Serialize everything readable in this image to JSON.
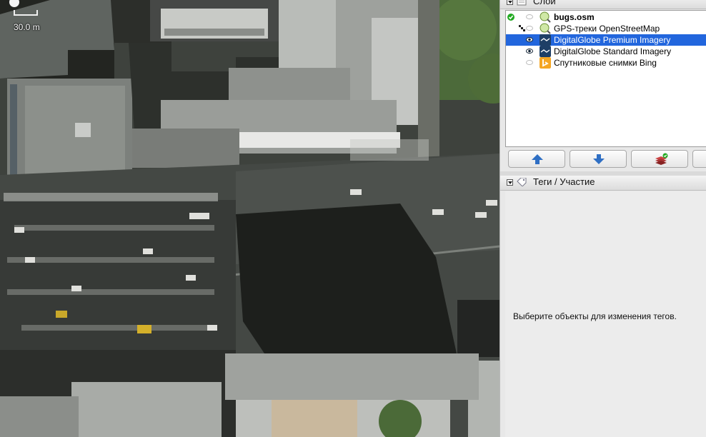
{
  "map": {
    "scale_label": "30.0 m"
  },
  "layers_panel": {
    "title": "Слои",
    "layers": [
      {
        "name": "bugs.osm",
        "bold": true,
        "selected": false,
        "status": "active",
        "visible": false,
        "icon": "osm-data-icon"
      },
      {
        "name": "GPS-треки OpenStreetMap",
        "bold": false,
        "selected": false,
        "status": "none",
        "visible": false,
        "icon": "gps-tracks-icon"
      },
      {
        "name": "DigitalGlobe Premium Imagery",
        "bold": false,
        "selected": true,
        "status": "none",
        "visible": true,
        "icon": "imagery-icon"
      },
      {
        "name": "DigitalGlobe Standard Imagery",
        "bold": false,
        "selected": false,
        "status": "none",
        "visible": true,
        "icon": "imagery-icon"
      },
      {
        "name": "Спутниковые снимки Bing",
        "bold": false,
        "selected": false,
        "status": "none",
        "visible": false,
        "icon": "bing-icon"
      }
    ],
    "buttons": [
      "move-up",
      "move-down",
      "merge"
    ]
  },
  "tags_panel": {
    "title": "Теги / Участие",
    "empty_message": "Выберите объекты для изменения тегов."
  },
  "colors": {
    "selection": "#2266dd",
    "active_check": "#22aa22",
    "arrow_blue": "#2f6fc4",
    "imagery_icon": "#1e3f66",
    "bing_icon": "#f5a623"
  }
}
